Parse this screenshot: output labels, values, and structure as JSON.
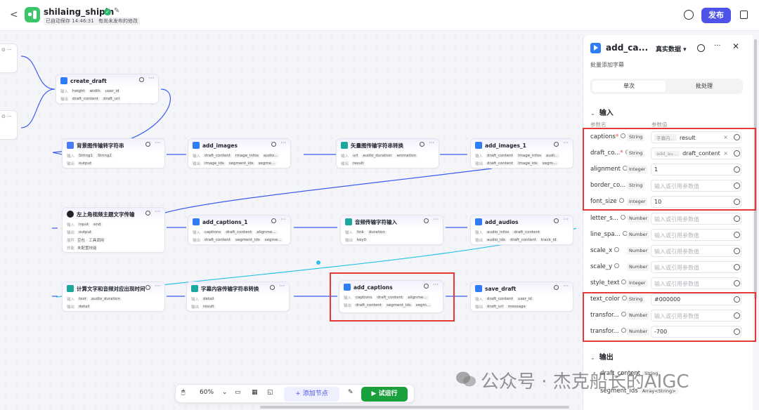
{
  "header": {
    "back": "<",
    "app_name": "shilaing_shipin",
    "autosave": "已自动保存 14:46:31",
    "unpublished": "有尚未发布的修改",
    "publish": "发布"
  },
  "nodes": {
    "create_draft": {
      "title": "create_draft",
      "in_label": "输入",
      "out_label": "输出",
      "inputs": [
        "height",
        "width",
        "user_id"
      ],
      "outputs": [
        "draft_content",
        "draft_url"
      ]
    },
    "bg_convert": {
      "title": "背景图传输转字符串",
      "inputs": [
        "String1",
        "String2"
      ],
      "outputs": [
        "output"
      ]
    },
    "add_images": {
      "title": "add_images",
      "inputs": [
        "draft_content",
        "image_infos",
        "audio..."
      ],
      "outputs": [
        "image_ids",
        "segment_ids",
        "segme..."
      ]
    },
    "vector_convert": {
      "title": "矢量图传输字符串转换",
      "inputs": [
        "url",
        "audio_duration",
        "animation"
      ],
      "outputs": [
        "result"
      ]
    },
    "add_images_1": {
      "title": "add_images_1",
      "inputs": [
        "draft_content",
        "image_infos",
        "audi..."
      ],
      "outputs": [
        "draft_content",
        "image_ids",
        "segm..."
      ]
    },
    "topleft_text": {
      "title": "左上角视频主题文字传输",
      "inputs": [
        "input",
        "end"
      ],
      "outputs": [
        "output"
      ],
      "extra1_label": "插件",
      "extra1": "豆包 · 工具调用",
      "extra2_label": "技能",
      "extra2": "未配置技能"
    },
    "add_captions_1": {
      "title": "add_captions_1",
      "inputs": [
        "captions",
        "draft_content",
        "alignme..."
      ],
      "outputs": [
        "draft_content",
        "segment_ids",
        "segme..."
      ]
    },
    "audio_convert": {
      "title": "音频传输字符输入",
      "inputs": [
        "link",
        "duration"
      ],
      "outputs": [
        "key0"
      ]
    },
    "add_audios": {
      "title": "add_audios",
      "inputs": [
        "audio_infos",
        "draft_content"
      ],
      "outputs": [
        "audio_ids",
        "draft_content",
        "track_id"
      ]
    },
    "calc_time": {
      "title": "计算文字和音频对应出现时间",
      "inputs": [
        "text",
        "audio_duration"
      ],
      "outputs": [
        "detail"
      ]
    },
    "caption_convert": {
      "title": "字幕内容传输字符串转换",
      "inputs": [
        "detail"
      ],
      "outputs": [
        "result"
      ]
    },
    "add_captions": {
      "title": "add_captions",
      "inputs": [
        "captions",
        "draft_content",
        "alignme..."
      ],
      "outputs": [
        "draft_content",
        "segment_ids",
        "segm..."
      ]
    },
    "save_draft": {
      "title": "save_draft",
      "inputs": [
        "draft_content",
        "user_id"
      ],
      "outputs": [
        "draft_url",
        "message"
      ]
    }
  },
  "toolbar": {
    "zoom": "60%",
    "add_node": "+ 添加节点",
    "run": "▶ 试运行"
  },
  "panel": {
    "title": "add_ca...",
    "real_data": "真实数据 ▾",
    "description": "批量添加字幕",
    "tab_single": "单次",
    "tab_batch": "批处理",
    "input_section": "输入",
    "col_param_name": "参数名",
    "col_param_value": "参数值",
    "placeholder": "输入或引用参数值",
    "params": [
      {
        "name": "captions",
        "required": true,
        "type": "String",
        "ref": "字幕内…",
        "value": "result"
      },
      {
        "name": "draft_co...",
        "required": true,
        "type": "String",
        "ref": "add_au…",
        "value": "draft_content"
      },
      {
        "name": "alignment",
        "type": "Integer",
        "value": "1"
      },
      {
        "name": "border_co...",
        "type": "String",
        "value": ""
      },
      {
        "name": "font_size",
        "type": "Integer",
        "value": "10"
      },
      {
        "name": "letter_s...",
        "type": "Number",
        "value": ""
      },
      {
        "name": "line_spa...",
        "type": "Number",
        "value": ""
      },
      {
        "name": "scale_x",
        "type": "Number",
        "value": ""
      },
      {
        "name": "scale_y",
        "type": "Number",
        "value": ""
      },
      {
        "name": "style_text",
        "type": "Integer",
        "value": ""
      },
      {
        "name": "text_color",
        "type": "String",
        "value": "#000000"
      },
      {
        "name": "transfor...",
        "type": "Number",
        "value": ""
      },
      {
        "name": "transfor...",
        "type": "Number",
        "value": "-700"
      }
    ],
    "output_section": "输出",
    "outputs": [
      {
        "name": "draft_content",
        "type": "String"
      },
      {
        "name": "segment_ids",
        "type": "Array<String>"
      }
    ]
  },
  "watermark": "公众号 · 杰克船长的AIGC"
}
